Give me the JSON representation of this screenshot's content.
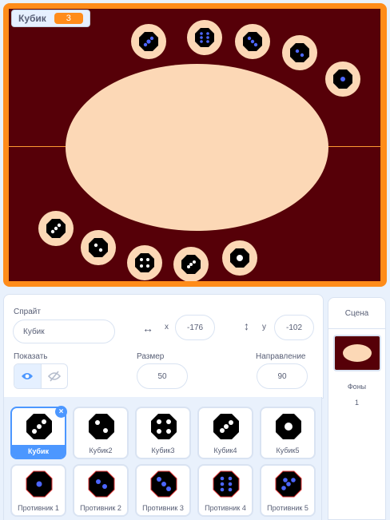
{
  "monitor": {
    "label": "Кубик",
    "value": "3"
  },
  "sprite_info": {
    "sprite_label": "Спрайт",
    "sprite_name": "Кубик",
    "x_label": "x",
    "x_value": "-176",
    "y_label": "y",
    "y_value": "-102",
    "show_label": "Показать",
    "size_label": "Размер",
    "size_value": "50",
    "direction_label": "Направление",
    "direction_value": "90"
  },
  "sprites": [
    {
      "name": "Кубик",
      "selected": true
    },
    {
      "name": "Кубик2"
    },
    {
      "name": "Кубик3"
    },
    {
      "name": "Кубик4"
    },
    {
      "name": "Кубик5"
    },
    {
      "name": "Противник 1"
    },
    {
      "name": "Противник 2"
    },
    {
      "name": "Противник 3"
    },
    {
      "name": "Противник 4"
    },
    {
      "name": "Противник 5"
    }
  ],
  "stage_panel": {
    "title": "Сцена",
    "backdrops_label": "Фоны",
    "backdrops_count": "1"
  },
  "colors": {
    "stage_bg": "#560008",
    "table": "#fcd8b6",
    "frame": "#ff8c1a",
    "accent": "#4c97ff",
    "pip_blue": "#4c66ff"
  }
}
